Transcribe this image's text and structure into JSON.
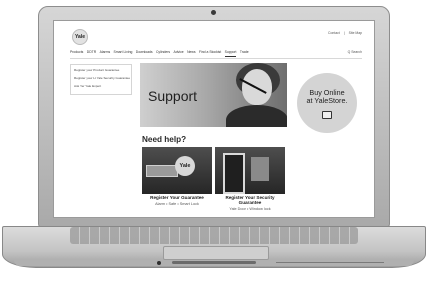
{
  "site": {
    "logo_text": "Yale",
    "util_links": [
      "Contact",
      "Site Map"
    ],
    "nav": [
      "Products",
      "DDTR",
      "Alarms",
      "Smart Living",
      "Downloads",
      "Cylinders",
      "Advice",
      "News",
      "Find a Stockist",
      "Support",
      "Trade"
    ],
    "active_nav": "Support",
    "search_label": "Q Search"
  },
  "sidebar": {
    "links": [
      "Register your Product Guarantee",
      "Register your Lt Yale Security Guarantee",
      "Ask Yer Yale Expert"
    ]
  },
  "hero": {
    "title": "Support"
  },
  "promo": {
    "line1": "Buy Online",
    "line2": "at YaleStore."
  },
  "section": {
    "heading": "Need help?"
  },
  "cards": [
    {
      "title": "Register Your Guarantee",
      "subtitle": "Alarm • Safe • Smart Lock",
      "badge": "Yale"
    },
    {
      "title": "Register Your Security Guarantee",
      "subtitle": "Yale Door • Window lock"
    }
  ]
}
